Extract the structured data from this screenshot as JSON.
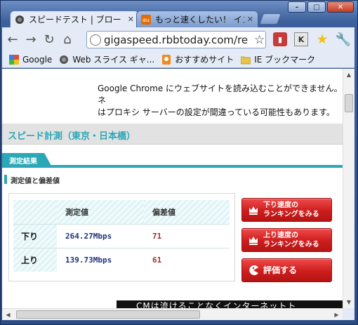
{
  "window": {
    "controls": [
      "-",
      "□",
      "✕"
    ]
  },
  "tabs": [
    {
      "label": "スピードテスト | ブロー",
      "close": "✕",
      "icon": "speedtest-favicon"
    },
    {
      "label": "もっと速くしたい！ イン",
      "close": "✕",
      "icon": "au-favicon",
      "icon_text": "au"
    }
  ],
  "toolbar": {
    "back": "←",
    "forward": "→",
    "reload": "↻",
    "home": "⌂",
    "url": "gigaspeed.rbbtoday.com/re",
    "bookmark_star": "☆",
    "ext_k": "K",
    "ext_star": "★",
    "wrench": "🔧"
  },
  "bookmarks": [
    {
      "label": "Google",
      "icon": "google-icon"
    },
    {
      "label": "Web スライス ギャ...",
      "icon": "web-slice-icon"
    },
    {
      "label": "おすすめサイト",
      "icon": "suggested-sites-icon"
    },
    {
      "label": "IE ブックマーク",
      "icon": "folder-icon"
    }
  ],
  "page": {
    "error_message": "Google Chrome にウェブサイトを読み込むことができません。ネ\nはプロキシ サーバーの設定が間違っている可能性もあります。",
    "speed_heading": "スピード計測（東京・日本橋）",
    "results_tab": "測定結果",
    "subheading": "測定値と偏差値",
    "table": {
      "headers": [
        "",
        "測定値",
        "偏差値"
      ],
      "rows": [
        {
          "label": "下り",
          "value": "264.27Mbps",
          "deviation": "71"
        },
        {
          "label": "上り",
          "value": "139.73Mbps",
          "deviation": "61"
        }
      ]
    },
    "buttons": [
      {
        "label_line1": "下り速度の",
        "label_line2": "ランキングをみる",
        "icon": "crown-icon"
      },
      {
        "label_line1": "上り速度の",
        "label_line2": "ランキングをみる",
        "icon": "crown-icon"
      },
      {
        "label": "評価する",
        "icon": "pacman-icon"
      }
    ],
    "banner_text": "CMは流けることなくインターネットト"
  },
  "colors": {
    "accent": "#2ba8b5",
    "speed_value": "#22327a",
    "deviation_value": "#a0302b",
    "button_red": "#cd1d1d"
  }
}
